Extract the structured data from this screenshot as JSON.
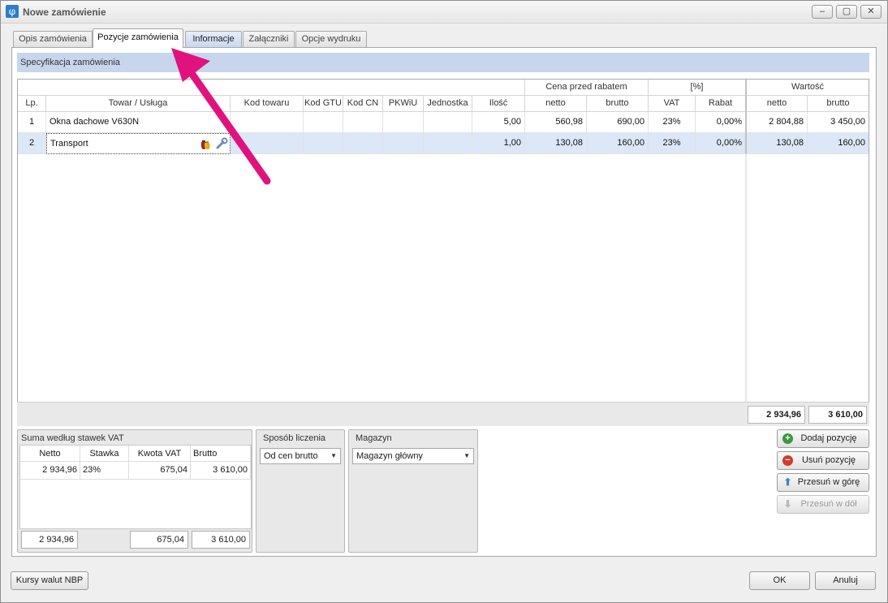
{
  "window": {
    "title": "Nowe zamówienie",
    "icon_glyph": "φ"
  },
  "tabs": [
    {
      "label": "Opis zamówienia"
    },
    {
      "label": "Pozycje zamówienia"
    },
    {
      "label": "Informacje"
    },
    {
      "label": "Załączniki"
    },
    {
      "label": "Opcje wydruku"
    }
  ],
  "active_tab": "Pozycje zamówienia",
  "spec_header": "Specyfikacja zamówienia",
  "grid": {
    "group_headers": {
      "cena": "Cena przed rabatem",
      "percent": "[%]",
      "wartosc": "Wartość"
    },
    "columns": [
      "Lp.",
      "Towar / Usługa",
      "Kod towaru",
      "Kod GTU",
      "Kod CN",
      "PKWiU",
      "Jednostka",
      "Ilość",
      "netto",
      "brutto",
      "VAT",
      "Rabat",
      "netto",
      "brutto"
    ],
    "rows": [
      {
        "lp": "1",
        "towar": "Okna dachowe V630N",
        "kod": "",
        "gtu": "",
        "cn": "",
        "pkwiu": "",
        "jedn": "",
        "ilosc": "5,00",
        "netto": "560,98",
        "brutto": "690,00",
        "vat": "23%",
        "rabat": "0,00%",
        "w_netto": "2 804,88",
        "w_brutto": "3 450,00"
      },
      {
        "lp": "2",
        "towar": "Transport",
        "kod": "",
        "gtu": "",
        "cn": "",
        "pkwiu": "",
        "jedn": "",
        "ilosc": "1,00",
        "netto": "130,08",
        "brutto": "160,00",
        "vat": "23%",
        "rabat": "0,00%",
        "w_netto": "130,08",
        "w_brutto": "160,00"
      }
    ],
    "totals": {
      "netto": "2 934,96",
      "brutto": "3 610,00"
    }
  },
  "vat_summary": {
    "title": "Suma według stawek VAT",
    "columns": [
      "Netto",
      "Stawka",
      "Kwota VAT",
      "Brutto"
    ],
    "rows": [
      {
        "netto": "2 934,96",
        "stawka": "23%",
        "kwota": "675,04",
        "brutto": "3 610,00"
      }
    ],
    "totals": {
      "netto": "2 934,96",
      "kwota": "675,04",
      "brutto": "3 610,00"
    }
  },
  "sposob": {
    "title": "Sposób liczenia",
    "value": "Od cen brutto"
  },
  "magazyn": {
    "title": "Magazyn",
    "value": "Magazyn główny"
  },
  "actions": {
    "add": "Dodaj pozycję",
    "remove": "Usuń pozycję",
    "up": "Przesuń w górę",
    "down": "Przesuń w dół"
  },
  "bottom": {
    "rates": "Kursy walut NBP",
    "ok": "OK",
    "cancel": "Anuluj"
  },
  "colors": {
    "highlight": "#dce7f7",
    "header": "#c7d6ec",
    "arrow": "#e0137e"
  }
}
